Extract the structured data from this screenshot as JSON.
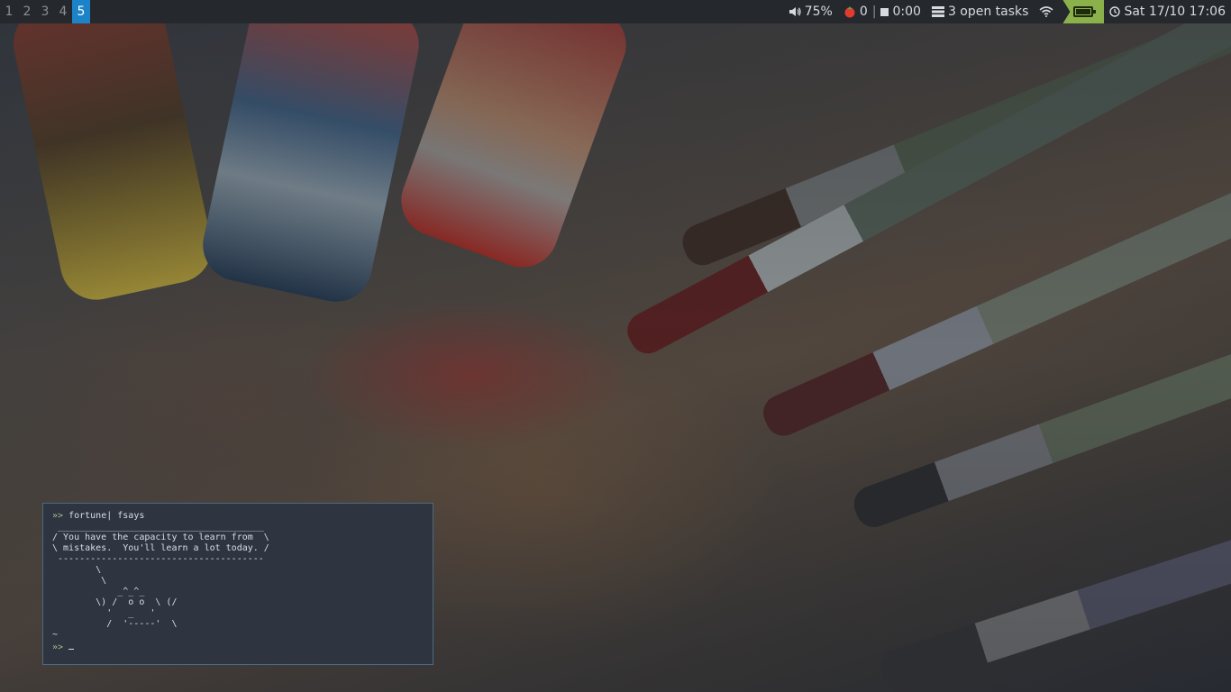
{
  "topbar": {
    "workspaces": [
      {
        "label": "1",
        "active": false
      },
      {
        "label": "2",
        "active": false
      },
      {
        "label": "3",
        "active": false
      },
      {
        "label": "4",
        "active": false
      },
      {
        "label": "5",
        "active": true
      }
    ],
    "volume": {
      "icon": "speaker-icon",
      "label": "75%"
    },
    "pomodoro": {
      "icon": "tomato-icon",
      "count": "0",
      "separator": "|",
      "timer_icon": "stop-square-icon",
      "time": "0:00"
    },
    "tasks": {
      "icon": "tasks-list-icon",
      "label": "3 open tasks"
    },
    "wifi": {
      "icon": "wifi-icon"
    },
    "battery": {
      "icon": "battery-icon",
      "level": 1.0,
      "color": "#8bb14a"
    },
    "clock": {
      "icon": "clock-icon",
      "label": "Sat 17/10 17:06"
    },
    "active_color": "#1d83c8"
  },
  "terminal": {
    "prompt": "»>",
    "command": "fortune| fsays",
    "output": [
      " ______________________________________",
      "/ You have the capacity to learn from  \\",
      "\\ mistakes.  You'll learn a lot today. /",
      " --------------------------------------",
      "        \\",
      "         \\",
      "            _^_^_",
      "        \\) /  o o  \\ (/",
      "          '   _   '",
      "          /  '-----'  \\",
      "~"
    ],
    "last_prompt": "»>"
  }
}
